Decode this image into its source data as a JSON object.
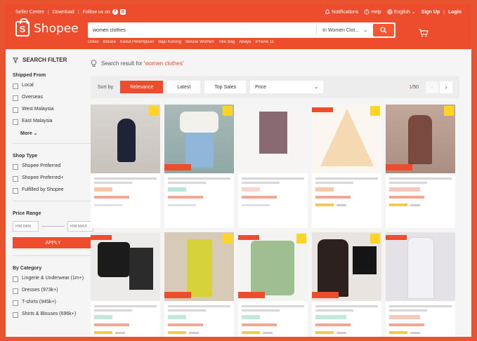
{
  "topbar": {
    "seller_centre": "Seller Centre",
    "download": "Download",
    "follow_us": "Follow us on",
    "notifications": "Notifications",
    "help": "Help",
    "language": "English",
    "sign_up": "Sign Up",
    "login": "Login"
  },
  "header": {
    "logo_text": "Shopee",
    "search_value": "women clothes",
    "search_scope": "In Women Clot...",
    "suggestions": [
      "Dress",
      "Blouse",
      "Kasut Perempuan",
      "Baju Kurung",
      "Blouse Women",
      "Tote Bag",
      "Abaya",
      "iPhone 11"
    ]
  },
  "sidebar": {
    "title": "SEARCH FILTER",
    "shipped_from": {
      "title": "Shipped From",
      "options": [
        "Local",
        "Overseas",
        "West Malaysia",
        "East Malaysia"
      ],
      "more": "More"
    },
    "shop_type": {
      "title": "Shop Type",
      "options": [
        "Shopee Preferred",
        "Shopee Preferred+",
        "Fulfilled by Shopee"
      ]
    },
    "price_range": {
      "title": "Price Range",
      "min_placeholder": "RM MIN",
      "max_placeholder": "RM MAX",
      "apply": "APPLY"
    },
    "by_category": {
      "title": "By Category",
      "options": [
        "Lingerie & Underwear (1m+)",
        "Dresses (973k+)",
        "T-shirts (945k+)",
        "Shirts & Blouses (696k+)"
      ]
    }
  },
  "main": {
    "result_prefix": "Search result for '",
    "result_keyword": "women clothes",
    "result_suffix": "'",
    "sort_by": "Sort by",
    "sort_options": [
      "Relevance",
      "Latest",
      "Top Sales"
    ],
    "price_label": "Price",
    "page_current": "1",
    "page_total": "/50"
  },
  "colors": {
    "brand": "#ee4d2d",
    "background": "#f5f5f5"
  }
}
